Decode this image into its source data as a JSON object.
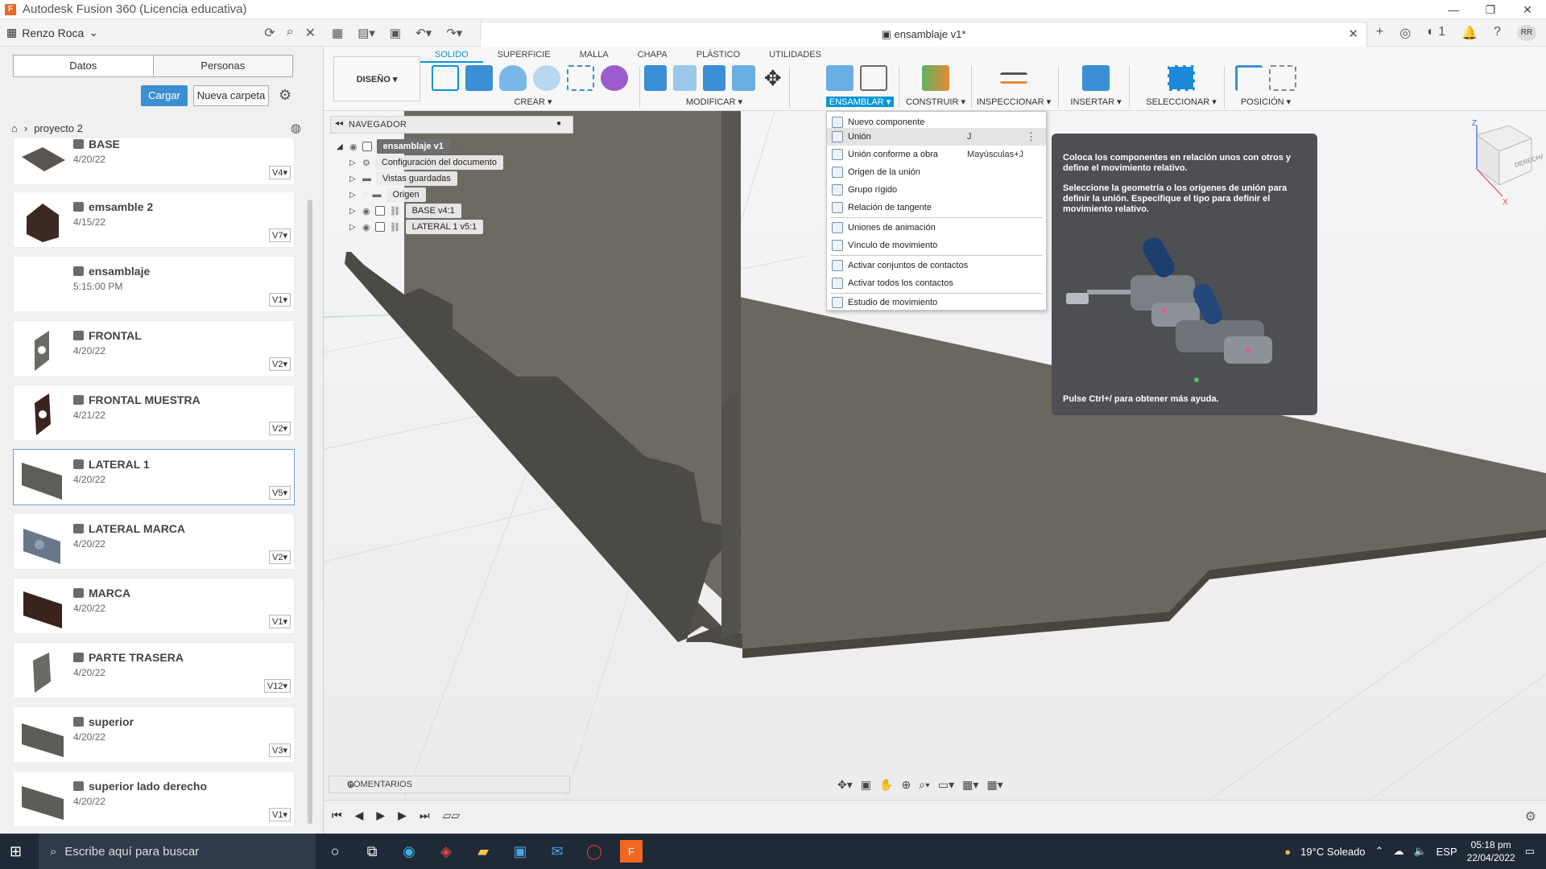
{
  "window": {
    "title": "Autodesk Fusion 360 (Licencia educativa)",
    "logo_letter": "F"
  },
  "datapanel": {
    "user": "Renzo Roca",
    "tabs": [
      "Datos",
      "Personas"
    ],
    "cargar_label": "Cargar",
    "nueva_carpeta_label": "Nueva carpeta",
    "breadcrumb": "proyecto 2",
    "files": [
      {
        "name": "BASE",
        "date": "4/20/22",
        "version": "V4"
      },
      {
        "name": "emsamble 2",
        "date": "4/15/22",
        "version": "V7"
      },
      {
        "name": "ensamblaje",
        "date": "5:15:00 PM",
        "version": "V1"
      },
      {
        "name": "FRONTAL",
        "date": "4/20/22",
        "version": "V2"
      },
      {
        "name": "FRONTAL MUESTRA",
        "date": "4/21/22",
        "version": "V2"
      },
      {
        "name": "LATERAL 1",
        "date": "4/20/22",
        "version": "V5"
      },
      {
        "name": "LATERAL MARCA",
        "date": "4/20/22",
        "version": "V2"
      },
      {
        "name": "MARCA",
        "date": "4/20/22",
        "version": "V1"
      },
      {
        "name": "PARTE TRASERA",
        "date": "4/20/22",
        "version": "V12"
      },
      {
        "name": "superior",
        "date": "4/20/22",
        "version": "V3"
      },
      {
        "name": "superior lado derecho",
        "date": "4/20/22",
        "version": "V1"
      }
    ]
  },
  "document": {
    "tab_title": "ensamblaje v1*",
    "user_initials": "RR",
    "notif_count": "1"
  },
  "ribbon": {
    "workspace": "DISEÑO",
    "tabs": [
      "SOLIDO",
      "SUPERFICIE",
      "MALLA",
      "CHAPA",
      "PLÁSTICO",
      "UTILIDADES"
    ],
    "active_tab": "SOLIDO",
    "groups": [
      "CREAR",
      "MODIFICAR",
      "ENSAMBLAR",
      "CONSTRUIR",
      "INSPECCIONAR",
      "INSERTAR",
      "SELECCIONAR",
      "POSICIÓN"
    ],
    "active_group": "ENSAMBLAR"
  },
  "navigator": {
    "title": "NAVEGADOR",
    "root": "ensamblaje v1",
    "items": [
      "Configuración del documento",
      "Vistas guardadas",
      "Origen",
      "BASE v4:1",
      "LATERAL 1 v5:1"
    ]
  },
  "menu": {
    "items": [
      {
        "label": "Nuevo componente",
        "shortcut": ""
      },
      {
        "label": "Unión",
        "shortcut": "J"
      },
      {
        "label": "Unión conforme a obra",
        "shortcut": "Mayúsculas+J"
      },
      {
        "label": "Origen de la unión",
        "shortcut": ""
      },
      {
        "label": "Grupo rígido",
        "shortcut": ""
      },
      {
        "label": "Relación de tangente",
        "shortcut": ""
      },
      {
        "label": "Uniones de animación",
        "shortcut": ""
      },
      {
        "label": "Vínculo de movimiento",
        "shortcut": ""
      },
      {
        "label": "Activar conjuntos de contactos",
        "shortcut": ""
      },
      {
        "label": "Activar todos los contactos",
        "shortcut": ""
      },
      {
        "label": "Estudio de movimiento",
        "shortcut": ""
      }
    ]
  },
  "tooltip": {
    "line1": "Coloca los componentes en relación unos con otros y define el movimiento relativo.",
    "line2": "Seleccione la geometría o los orígenes de unión para definir la unión. Especifique el tipo para definir el movimiento relativo.",
    "footer": "Pulse Ctrl+/ para obtener más ayuda."
  },
  "viewcube": {
    "face": "DERECHA",
    "axis_z": "Z",
    "axis_x": "X"
  },
  "comments_label": "COMENTARIOS",
  "taskbar": {
    "search_placeholder": "Escribe aquí para buscar",
    "weather": "19°C Soleado",
    "lang": "ESP",
    "time": "05:18 pm",
    "date": "22/04/2022"
  },
  "colors": {
    "accent": "#0696d7",
    "panel_surface": "#6a6760",
    "panel_edge": "#4a4843"
  }
}
